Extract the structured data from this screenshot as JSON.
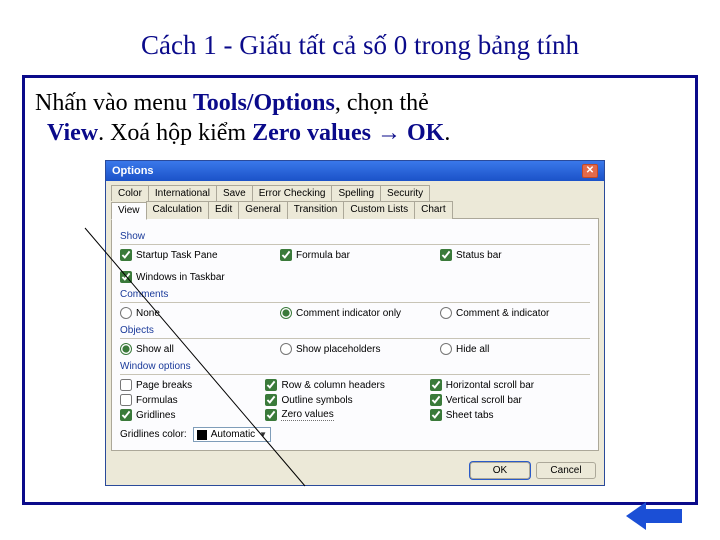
{
  "title": "Cách 1 - Giấu tất cả số 0 trong bảng tính",
  "instruction": {
    "pre": "Nhấn vào menu ",
    "b1": "Tools/Options",
    "mid1": ", chọn thẻ ",
    "b2": "View",
    "mid2": ". Xoá hộp kiểm ",
    "b3": "Zero values",
    "arrow": " → ",
    "b4": "OK",
    "end": "."
  },
  "dialog": {
    "title": "Options",
    "tabs_row1": [
      "Color",
      "International",
      "Save",
      "Error Checking",
      "Spelling",
      "Security"
    ],
    "tabs_row2": [
      "View",
      "Calculation",
      "Edit",
      "General",
      "Transition",
      "Custom Lists",
      "Chart"
    ],
    "active_tab": "View",
    "sections": {
      "show": {
        "label": "Show",
        "items": [
          {
            "label": "Startup Task Pane",
            "checked": true
          },
          {
            "label": "Formula bar",
            "checked": true
          },
          {
            "label": "Status bar",
            "checked": true
          },
          {
            "label": "Windows in Taskbar",
            "checked": true
          }
        ]
      },
      "comments": {
        "label": "Comments",
        "items": [
          {
            "label": "None",
            "checked": false
          },
          {
            "label": "Comment indicator only",
            "checked": true
          },
          {
            "label": "Comment & indicator",
            "checked": false
          }
        ]
      },
      "objects": {
        "label": "Objects",
        "items": [
          {
            "label": "Show all",
            "checked": true
          },
          {
            "label": "Show placeholders",
            "checked": false
          },
          {
            "label": "Hide all",
            "checked": false
          }
        ]
      },
      "window": {
        "label": "Window options",
        "left": [
          {
            "label": "Page breaks",
            "checked": false
          },
          {
            "label": "Formulas",
            "checked": false
          },
          {
            "label": "Gridlines",
            "checked": true
          }
        ],
        "mid": [
          {
            "label": "Row & column headers",
            "checked": true
          },
          {
            "label": "Outline symbols",
            "checked": true
          },
          {
            "label": "Zero values",
            "checked": true,
            "highlight": true
          }
        ],
        "right": [
          {
            "label": "Horizontal scroll bar",
            "checked": true
          },
          {
            "label": "Vertical scroll bar",
            "checked": true
          },
          {
            "label": "Sheet tabs",
            "checked": true
          }
        ],
        "gridcolor_label": "Gridlines color:",
        "gridcolor_value": "Automatic"
      }
    },
    "buttons": {
      "ok": "OK",
      "cancel": "Cancel"
    }
  }
}
